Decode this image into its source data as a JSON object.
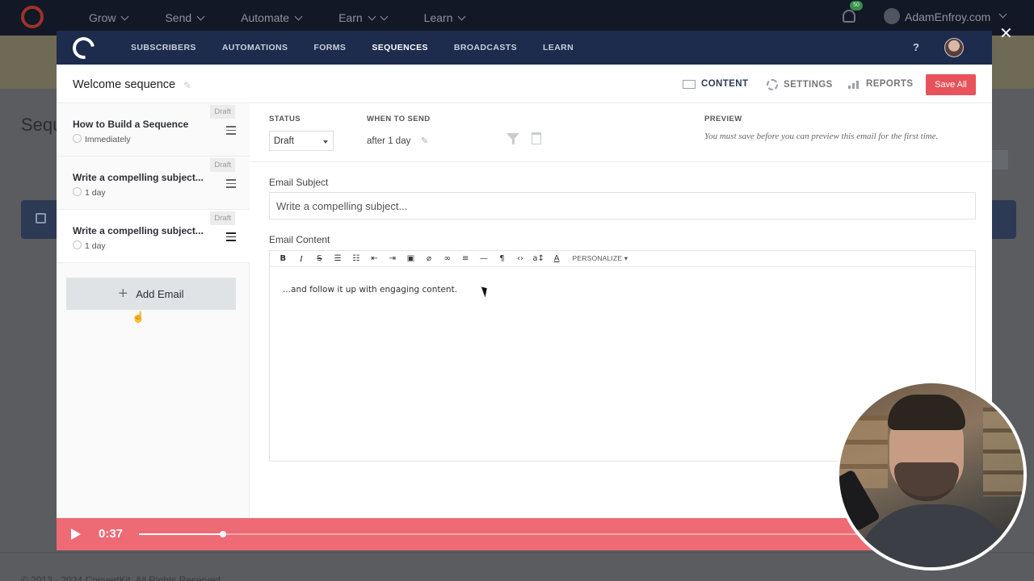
{
  "site_nav": {
    "items": [
      "Grow",
      "Send",
      "Automate",
      "Earn",
      "Learn"
    ],
    "notification_count": "50",
    "user": "AdamEnfroy.com"
  },
  "background": {
    "page_title_partial": "Sequ",
    "footer": "© 2013 - 2024 ConvertKit. All Rights Reserved."
  },
  "app_nav": {
    "items": [
      {
        "label": "SUBSCRIBERS",
        "active": false
      },
      {
        "label": "AUTOMATIONS",
        "active": false
      },
      {
        "label": "FORMS",
        "active": false
      },
      {
        "label": "SEQUENCES",
        "active": true
      },
      {
        "label": "BROADCASTS",
        "active": false
      },
      {
        "label": "LEARN",
        "active": false
      }
    ],
    "help": "?"
  },
  "sequence": {
    "title": "Welcome sequence",
    "tabs": {
      "content": "CONTENT",
      "settings": "SETTINGS",
      "reports": "REPORTS"
    },
    "save_all": "Save All"
  },
  "emails": [
    {
      "name": "How to Build a Sequence",
      "when": "Immediately",
      "badge": "Draft"
    },
    {
      "name": "Write a compelling subject...",
      "when": "1 day",
      "badge": "Draft"
    },
    {
      "name": "Write a compelling subject...",
      "when": "1 day",
      "badge": "Draft"
    }
  ],
  "add_email": "Add Email",
  "editor": {
    "status_label": "STATUS",
    "status_value": "Draft",
    "when_label": "WHEN TO SEND",
    "when_value": "after 1 day",
    "preview_label": "PREVIEW",
    "preview_note": "You must save before you can preview this email for the first time.",
    "subject_label": "Email Subject",
    "subject_placeholder": "Write a compelling subject...",
    "content_label": "Email Content",
    "personalize": "PERSONALIZE ▾",
    "body": "...and follow it up with engaging content."
  },
  "player": {
    "time": "0:37",
    "progress": 0.115
  },
  "colors": {
    "accent": "#e8525a",
    "nav": "#1d2b4d",
    "player": "#ee6a74"
  }
}
